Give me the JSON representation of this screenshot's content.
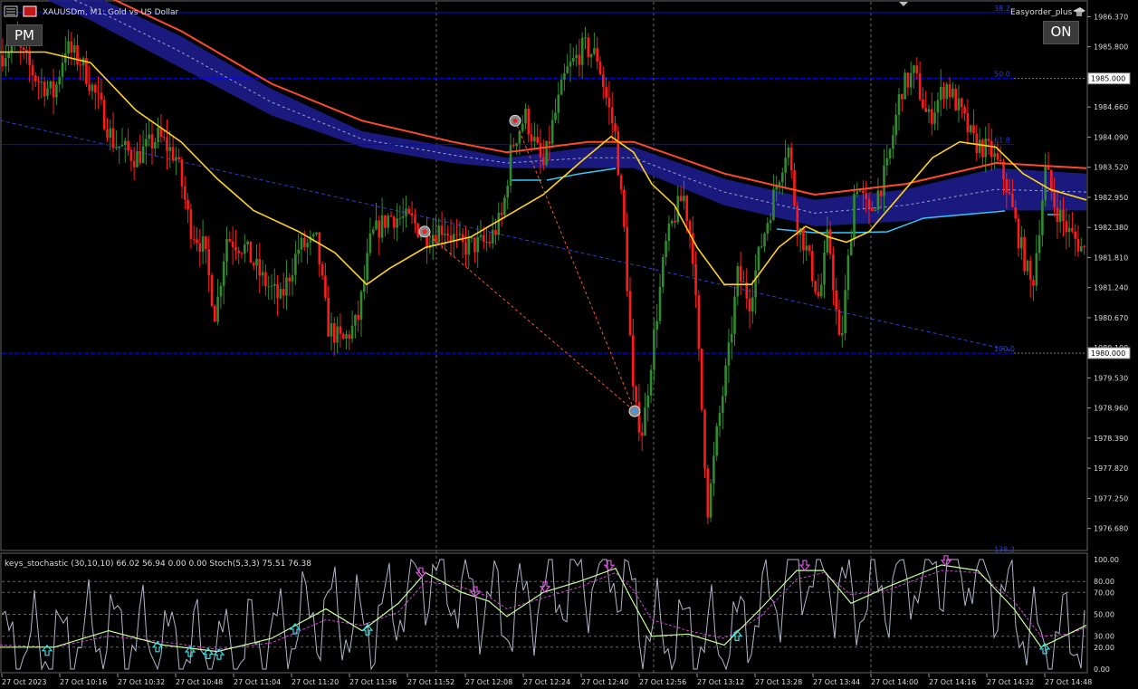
{
  "window": {
    "symbol_title": "XAUUSDm, M1:  Gold vs US Dollar",
    "expert_name": "Easyorder_plus"
  },
  "buttons": {
    "pm_label": "PM",
    "on_label": "ON"
  },
  "fibo_labels": [
    "38.2",
    "50.0",
    "61.8",
    "100.0",
    "138.2"
  ],
  "price_markers": [
    "1985.000",
    "1980.000"
  ],
  "price_axis": [
    "1986.370",
    "1985.800",
    "1985.230",
    "1984.660",
    "1984.090",
    "1983.520",
    "1982.950",
    "1982.380",
    "1981.810",
    "1981.240",
    "1980.670",
    "1980.100",
    "1979.530",
    "1978.960",
    "1978.390",
    "1977.820",
    "1977.250",
    "1976.680"
  ],
  "indicator_label": "keys_stochastic (30,10,10) 66.02 56.94 0.00 0.00 Stoch(5,3,3) 75.51 76.38",
  "indicator_axis": [
    "100.00",
    "80.00",
    "70.00",
    "50.00",
    "30.00",
    "20.00",
    "0.00"
  ],
  "time_axis": [
    "27 Oct 2023",
    "27 Oct 10:16",
    "27 Oct 10:32",
    "27 Oct 10:48",
    "27 Oct 11:04",
    "27 Oct 11:20",
    "27 Oct 11:36",
    "27 Oct 11:52",
    "27 Oct 12:08",
    "27 Oct 12:24",
    "27 Oct 12:40",
    "27 Oct 12:56",
    "27 Oct 13:12",
    "27 Oct 13:28",
    "27 Oct 13:44",
    "27 Oct 14:00",
    "27 Oct 14:16",
    "27 Oct 14:32",
    "27 Oct 14:48"
  ],
  "colors": {
    "bull": "#2e8b2e",
    "bear": "#ff1a1a",
    "fibo_line": "#0000ff",
    "ma_fast": "#ffd21a",
    "ma_slow": "#ff4a2a",
    "band": "#1c1c8c",
    "cyan": "#35c7ff",
    "stoch_main": "#c8ff9a",
    "stoch_signal": "#cc44cc",
    "stoch_fast": "#b0b6c8"
  },
  "chart_data": {
    "type": "candlestick",
    "timeframe": "M1",
    "ylim": [
      1976.4,
      1986.6
    ],
    "price_path": [
      [
        0,
        1985.6
      ],
      [
        16,
        1985.9
      ],
      [
        40,
        1985.2
      ],
      [
        60,
        1984.9
      ],
      [
        72,
        1985.8
      ],
      [
        90,
        1985.5
      ],
      [
        110,
        1984.7
      ],
      [
        125,
        1984.0
      ],
      [
        150,
        1983.7
      ],
      [
        175,
        1984.1
      ],
      [
        195,
        1983.7
      ],
      [
        210,
        1982.4
      ],
      [
        225,
        1982.0
      ],
      [
        238,
        1980.7
      ],
      [
        250,
        1982.2
      ],
      [
        270,
        1982.0
      ],
      [
        290,
        1981.4
      ],
      [
        310,
        1981.0
      ],
      [
        330,
        1982.0
      ],
      [
        350,
        1982.1
      ],
      [
        362,
        1980.5
      ],
      [
        378,
        1980.2
      ],
      [
        395,
        1980.6
      ],
      [
        410,
        1982.2
      ],
      [
        430,
        1982.6
      ],
      [
        455,
        1982.5
      ],
      [
        470,
        1982.2
      ],
      [
        490,
        1982.4
      ],
      [
        510,
        1982.0
      ],
      [
        540,
        1982.1
      ],
      [
        555,
        1982.6
      ],
      [
        565,
        1983.9
      ],
      [
        580,
        1984.5
      ],
      [
        600,
        1983.5
      ],
      [
        610,
        1984.3
      ],
      [
        625,
        1985.3
      ],
      [
        645,
        1985.8
      ],
      [
        660,
        1985.6
      ],
      [
        670,
        1984.8
      ],
      [
        680,
        1984.1
      ],
      [
        690,
        1982.2
      ],
      [
        700,
        1979.0
      ],
      [
        710,
        1978.5
      ],
      [
        720,
        1980.0
      ],
      [
        735,
        1982.0
      ],
      [
        745,
        1982.6
      ],
      [
        755,
        1983.0
      ],
      [
        765,
        1982.0
      ],
      [
        775,
        1979.0
      ],
      [
        782,
        1977.0
      ],
      [
        792,
        1978.5
      ],
      [
        805,
        1980.0
      ],
      [
        815,
        1981.5
      ],
      [
        828,
        1981.0
      ],
      [
        840,
        1982.0
      ],
      [
        855,
        1983.0
      ],
      [
        870,
        1984.0
      ],
      [
        880,
        1982.5
      ],
      [
        890,
        1982.0
      ],
      [
        905,
        1981.0
      ],
      [
        915,
        1982.3
      ],
      [
        928,
        1980.0
      ],
      [
        945,
        1983.3
      ],
      [
        960,
        1982.6
      ],
      [
        980,
        1983.5
      ],
      [
        995,
        1985.0
      ],
      [
        1010,
        1985.3
      ],
      [
        1025,
        1984.4
      ],
      [
        1045,
        1985.1
      ],
      [
        1060,
        1984.6
      ],
      [
        1075,
        1984.0
      ],
      [
        1095,
        1983.8
      ],
      [
        1110,
        1983.3
      ],
      [
        1125,
        1982.2
      ],
      [
        1140,
        1981.2
      ],
      [
        1155,
        1983.5
      ],
      [
        1165,
        1982.8
      ],
      [
        1180,
        1982.3
      ],
      [
        1200,
        1981.9
      ]
    ],
    "horizontal_levels": [
      {
        "label": "38.2",
        "price": 1986.45
      },
      {
        "label": "50.0",
        "price": 1985.2
      },
      {
        "label": "61.8",
        "price": 1983.95
      },
      {
        "label": "100.0",
        "price": 1980.0
      },
      {
        "label": "138.2",
        "price": 1976.2
      }
    ],
    "ma_slow": [
      [
        0,
        1987.6
      ],
      [
        100,
        1986.9
      ],
      [
        200,
        1986.1
      ],
      [
        300,
        1985.1
      ],
      [
        400,
        1984.4
      ],
      [
        500,
        1984.0
      ],
      [
        560,
        1983.8
      ],
      [
        650,
        1984.0
      ],
      [
        700,
        1984.0
      ],
      [
        800,
        1983.4
      ],
      [
        900,
        1983.0
      ],
      [
        1000,
        1983.2
      ],
      [
        1100,
        1983.6
      ],
      [
        1200,
        1983.5
      ]
    ],
    "band_upper": [
      [
        0,
        1987.5
      ],
      [
        100,
        1986.8
      ],
      [
        200,
        1986.0
      ],
      [
        300,
        1985.0
      ],
      [
        400,
        1984.2
      ],
      [
        500,
        1983.9
      ],
      [
        560,
        1983.7
      ],
      [
        650,
        1983.9
      ],
      [
        700,
        1983.9
      ],
      [
        800,
        1983.3
      ],
      [
        900,
        1982.9
      ],
      [
        1000,
        1983.1
      ],
      [
        1100,
        1983.5
      ],
      [
        1200,
        1983.4
      ]
    ],
    "band_lower": [
      [
        0,
        1987.1
      ],
      [
        100,
        1986.3
      ],
      [
        200,
        1985.4
      ],
      [
        300,
        1984.5
      ],
      [
        400,
        1983.9
      ],
      [
        500,
        1983.6
      ],
      [
        560,
        1983.5
      ],
      [
        650,
        1983.5
      ],
      [
        700,
        1983.5
      ],
      [
        800,
        1982.8
      ],
      [
        900,
        1982.4
      ],
      [
        1000,
        1982.5
      ],
      [
        1100,
        1982.7
      ],
      [
        1200,
        1982.7
      ]
    ],
    "ma_fast": [
      [
        0,
        1985.7
      ],
      [
        50,
        1985.7
      ],
      [
        100,
        1985.5
      ],
      [
        150,
        1984.6
      ],
      [
        200,
        1984.0
      ],
      [
        240,
        1983.3
      ],
      [
        280,
        1982.7
      ],
      [
        330,
        1982.3
      ],
      [
        370,
        1981.9
      ],
      [
        405,
        1981.3
      ],
      [
        430,
        1981.6
      ],
      [
        470,
        1982.0
      ],
      [
        520,
        1982.2
      ],
      [
        560,
        1982.6
      ],
      [
        600,
        1983.0
      ],
      [
        640,
        1983.6
      ],
      [
        675,
        1984.1
      ],
      [
        700,
        1983.8
      ],
      [
        720,
        1983.2
      ],
      [
        745,
        1982.8
      ],
      [
        770,
        1982.0
      ],
      [
        800,
        1981.3
      ],
      [
        830,
        1981.3
      ],
      [
        860,
        1982.0
      ],
      [
        890,
        1982.4
      ],
      [
        915,
        1982.2
      ],
      [
        935,
        1982.1
      ],
      [
        960,
        1982.3
      ],
      [
        990,
        1982.9
      ],
      [
        1030,
        1983.7
      ],
      [
        1060,
        1984.0
      ],
      [
        1100,
        1983.9
      ],
      [
        1130,
        1983.4
      ],
      [
        1160,
        1983.1
      ],
      [
        1200,
        1982.9
      ]
    ],
    "signals_sell": [
      [
        569,
        1984.4
      ],
      [
        469,
        1982.3
      ]
    ],
    "signals_buy": [
      [
        701,
        1978.9
      ]
    ],
    "stochastic": {
      "main": [
        [
          0,
          20
        ],
        [
          60,
          20
        ],
        [
          120,
          35
        ],
        [
          180,
          22
        ],
        [
          240,
          16
        ],
        [
          300,
          28
        ],
        [
          360,
          55
        ],
        [
          400,
          35
        ],
        [
          440,
          60
        ],
        [
          470,
          88
        ],
        [
          510,
          70
        ],
        [
          540,
          62
        ],
        [
          560,
          48
        ],
        [
          600,
          70
        ],
        [
          640,
          80
        ],
        [
          680,
          92
        ],
        [
          700,
          60
        ],
        [
          720,
          30
        ],
        [
          760,
          32
        ],
        [
          800,
          22
        ],
        [
          840,
          55
        ],
        [
          880,
          90
        ],
        [
          910,
          90
        ],
        [
          940,
          60
        ],
        [
          980,
          75
        ],
        [
          1040,
          95
        ],
        [
          1080,
          90
        ],
        [
          1120,
          55
        ],
        [
          1150,
          20
        ],
        [
          1180,
          32
        ],
        [
          1200,
          40
        ]
      ],
      "signal": [
        [
          0,
          22
        ],
        [
          60,
          20
        ],
        [
          120,
          30
        ],
        [
          180,
          25
        ],
        [
          240,
          18
        ],
        [
          300,
          24
        ],
        [
          360,
          45
        ],
        [
          400,
          40
        ],
        [
          440,
          52
        ],
        [
          470,
          80
        ],
        [
          510,
          75
        ],
        [
          540,
          66
        ],
        [
          560,
          55
        ],
        [
          600,
          65
        ],
        [
          640,
          75
        ],
        [
          680,
          88
        ],
        [
          700,
          72
        ],
        [
          720,
          45
        ],
        [
          760,
          35
        ],
        [
          800,
          28
        ],
        [
          840,
          48
        ],
        [
          880,
          82
        ],
        [
          910,
          88
        ],
        [
          940,
          68
        ],
        [
          980,
          72
        ],
        [
          1040,
          90
        ],
        [
          1080,
          88
        ],
        [
          1120,
          62
        ],
        [
          1150,
          30
        ],
        [
          1180,
          32
        ],
        [
          1200,
          38
        ]
      ],
      "arrows_up": [
        52,
        174,
        210,
        230,
        242,
        326,
        406,
        814,
        1154
      ],
      "arrows_down": [
        465,
        525,
        602,
        673,
        889,
        1045
      ]
    }
  }
}
